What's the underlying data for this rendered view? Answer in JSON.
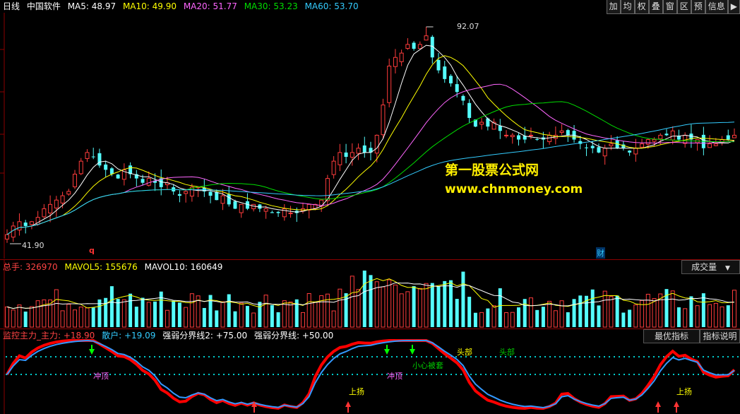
{
  "main_panel": {
    "period_label": "日线",
    "stock_name": "中国软件",
    "ma": [
      {
        "label": "MA5: 48.97",
        "color": "#ffffff"
      },
      {
        "label": "MA10: 49.90",
        "color": "#ffff00"
      },
      {
        "label": "MA20: 51.77",
        "color": "#ff66ff"
      },
      {
        "label": "MA30: 53.23",
        "color": "#00dd00"
      },
      {
        "label": "MA60: 53.70",
        "color": "#33ccff"
      }
    ],
    "high_label": "92.07",
    "low_label": "41.90",
    "marker_q": "q",
    "marker_cai": "财"
  },
  "toolbar": [
    "加",
    "均",
    "权",
    "叠",
    "窗",
    "区",
    "预",
    "信息",
    "▶"
  ],
  "volume_panel": {
    "total_label": "总手: 326970",
    "mavol5_label": "MAVOL5: 155676",
    "mavol10_label": "MAVOL10: 160649",
    "selector_label": "成交量",
    "selector_arrow": "▼"
  },
  "indicator_panel": {
    "main_label": "监控主力_主力: +18.90",
    "retail_label": "散户: +19.09",
    "line2_label": "强弱分界线2: +75.00",
    "line_label": "强弱分界线: +50.00",
    "best_button": "最优指标",
    "explain_button": "指标说明",
    "annotations": [
      "冲顶",
      "小心被套",
      "头部",
      "头部",
      "上扬",
      "冲顶",
      "上扬"
    ]
  },
  "watermark": {
    "line1": "第一股票公式网",
    "line2": "www.chnmoney.com"
  },
  "colors": {
    "up": "#ff3c3c",
    "down": "#54fcfc",
    "frame": "#8b0000",
    "main_line": "#ff0000",
    "retail_line": "#3399ff",
    "dotted": "#00cccc"
  },
  "chart_data": {
    "type": "candlestick",
    "price_axis": {
      "high": 92.07,
      "low": 41.9
    },
    "closes": [
      44,
      46,
      47,
      46,
      47,
      48,
      50,
      51,
      52,
      53,
      54,
      58,
      61,
      63,
      62,
      60,
      59,
      58,
      57,
      59,
      58,
      57,
      56,
      57,
      56,
      55,
      56,
      54,
      53,
      54,
      55,
      55,
      54,
      53,
      52,
      53,
      51,
      50,
      51,
      50,
      51,
      50,
      50,
      49,
      49,
      50,
      49,
      49,
      50,
      51,
      51,
      52,
      57,
      61,
      63,
      62,
      63,
      64,
      63,
      63,
      67,
      74,
      83,
      85,
      86,
      88,
      87,
      88,
      90,
      85,
      82,
      80,
      79,
      77,
      75,
      71,
      69,
      70,
      69,
      70,
      68,
      67,
      67,
      66,
      66,
      67,
      66,
      66,
      67,
      67,
      68,
      67,
      66,
      65,
      64,
      64,
      63,
      64,
      65,
      64,
      64,
      63,
      64,
      65,
      66,
      66,
      67,
      67,
      68,
      66,
      67,
      66,
      66,
      64,
      65,
      65,
      66,
      66,
      67
    ],
    "volume_series": "relative volume bars (unlabeled)",
    "indicator_levels": [
      75,
      50
    ]
  }
}
